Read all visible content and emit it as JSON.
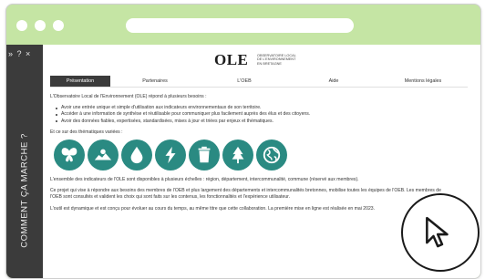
{
  "sidebar": {
    "controls": "» ? ×",
    "vertical_label": "COMMENT ÇA MARCHE ?"
  },
  "logo": {
    "mark": "OLE",
    "sub": "OBSERVATOIRE LOCAL DE L'ENVIRONNEMENT EN BRETAGNE"
  },
  "nav": {
    "items": [
      "Présentation",
      "Partenaires",
      "L'OEB",
      "Aide",
      "Mentions légales"
    ],
    "active": "Présentation"
  },
  "content": {
    "intro": "L'Observatoire Local de l'Environnement (OLE) répond à plusieurs besoins :",
    "needs": [
      "Avoir une entrée unique et simple d'utilisation aux indicateurs environnementaux de son territoire.",
      "Accéder à une information de synthèse et réutilisable pour communiquer plus facilement auprès des élus et des citoyens.",
      "Avoir des données fiables, expertisées, standardisées, mises à jour et triées par enjeux et thématiques."
    ],
    "themes_intro": "Et ce sur des thématiques variées :",
    "theme_icons": [
      "butterfly-icon",
      "landscape-icon",
      "water-drop-icon",
      "energy-bolt-icon",
      "waste-bin-icon",
      "forest-icon",
      "globe-icon"
    ],
    "scales": "L'ensemble des indicateurs de l'OLE sont disponibles à plusieurs échelles : région, département, intercommunalité, commune (réservé aux membres).",
    "project": "Ce projet qui vise à répondre aux besoins des membres de l'OEB et plus largement des départements et intercommunalités bretonnes, mobilise toutes les équipes de l'OEB. Les membres de l'OEB sont consultés et valident les choix qui sont faits sur les contenus, les fonctionnalités et l'expérience utilisateur.",
    "evolution": "L'outil est dynamique et est conçu pour évoluer au cours du temps, au même titre que cette collaboration. La première mise en ligne est réalisée en mai 2023."
  },
  "colors": {
    "frame": "#c5e5a4",
    "sidebar": "#3b3b3b",
    "icon_teal": "#2a8a82",
    "nav_active": "#3b3b3b"
  }
}
